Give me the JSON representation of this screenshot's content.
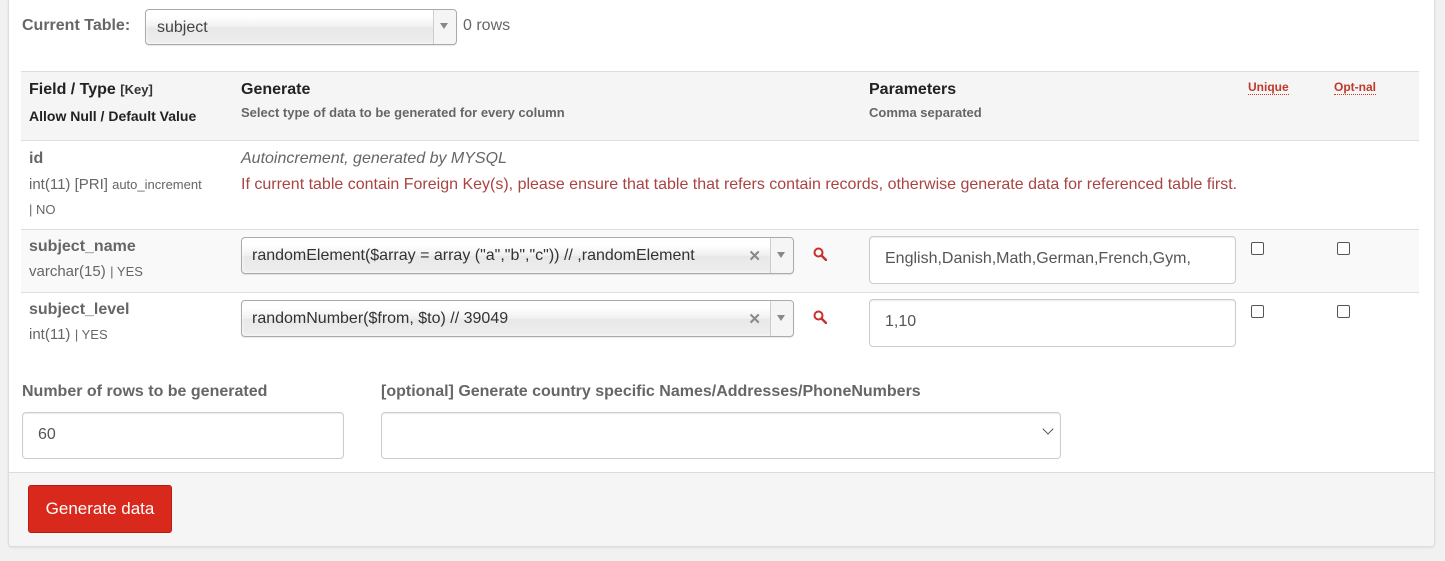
{
  "header": {
    "current_table_label": "Current Table:",
    "current_table_value": "subject",
    "rows_count": "0 rows"
  },
  "columns": {
    "field_type": "Field / Type",
    "key": "[Key]",
    "allow_null": "Allow Null / Default Value",
    "generate": "Generate",
    "generate_sub": "Select type of data to be generated for every column",
    "parameters": "Parameters",
    "parameters_sub": "Comma separated",
    "unique": "Unique",
    "optional": "Opt-nal"
  },
  "rows": [
    {
      "name": "id",
      "type": "int(11) [PRI]",
      "extra": "auto_increment",
      "nullable": "| NO",
      "note": "Autoincrement, generated by MYSQL",
      "warning": "If current table contain Foreign Key(s), please ensure that table that refers contain records, otherwise generate data for referenced table first."
    },
    {
      "name": "subject_name",
      "type": "varchar(15)",
      "nullable": "| YES",
      "generator": "randomElement($array = array (\"a\",\"b\",\"c\")) // ,randomElement",
      "parameters": "English,Danish,Math,German,French,Gym,",
      "unique": false,
      "optional": false
    },
    {
      "name": "subject_level",
      "type": "int(11)",
      "nullable": "| YES",
      "generator": "randomNumber($from, $to) // 39049",
      "parameters": "1,10",
      "unique": false,
      "optional": false
    }
  ],
  "footer": {
    "rows_label": "Number of rows to be generated",
    "rows_value": "60",
    "country_label": "[optional] Generate country specific Names/Addresses/PhoneNumbers",
    "country_value": "",
    "generate_button": "Generate data"
  },
  "colors": {
    "accent_red": "#d9291c",
    "warning_red": "#a94442",
    "link_red": "#c0392b"
  },
  "icons": [
    "chevron-down-icon",
    "clear-icon",
    "search-icon",
    "checkbox-icon"
  ]
}
